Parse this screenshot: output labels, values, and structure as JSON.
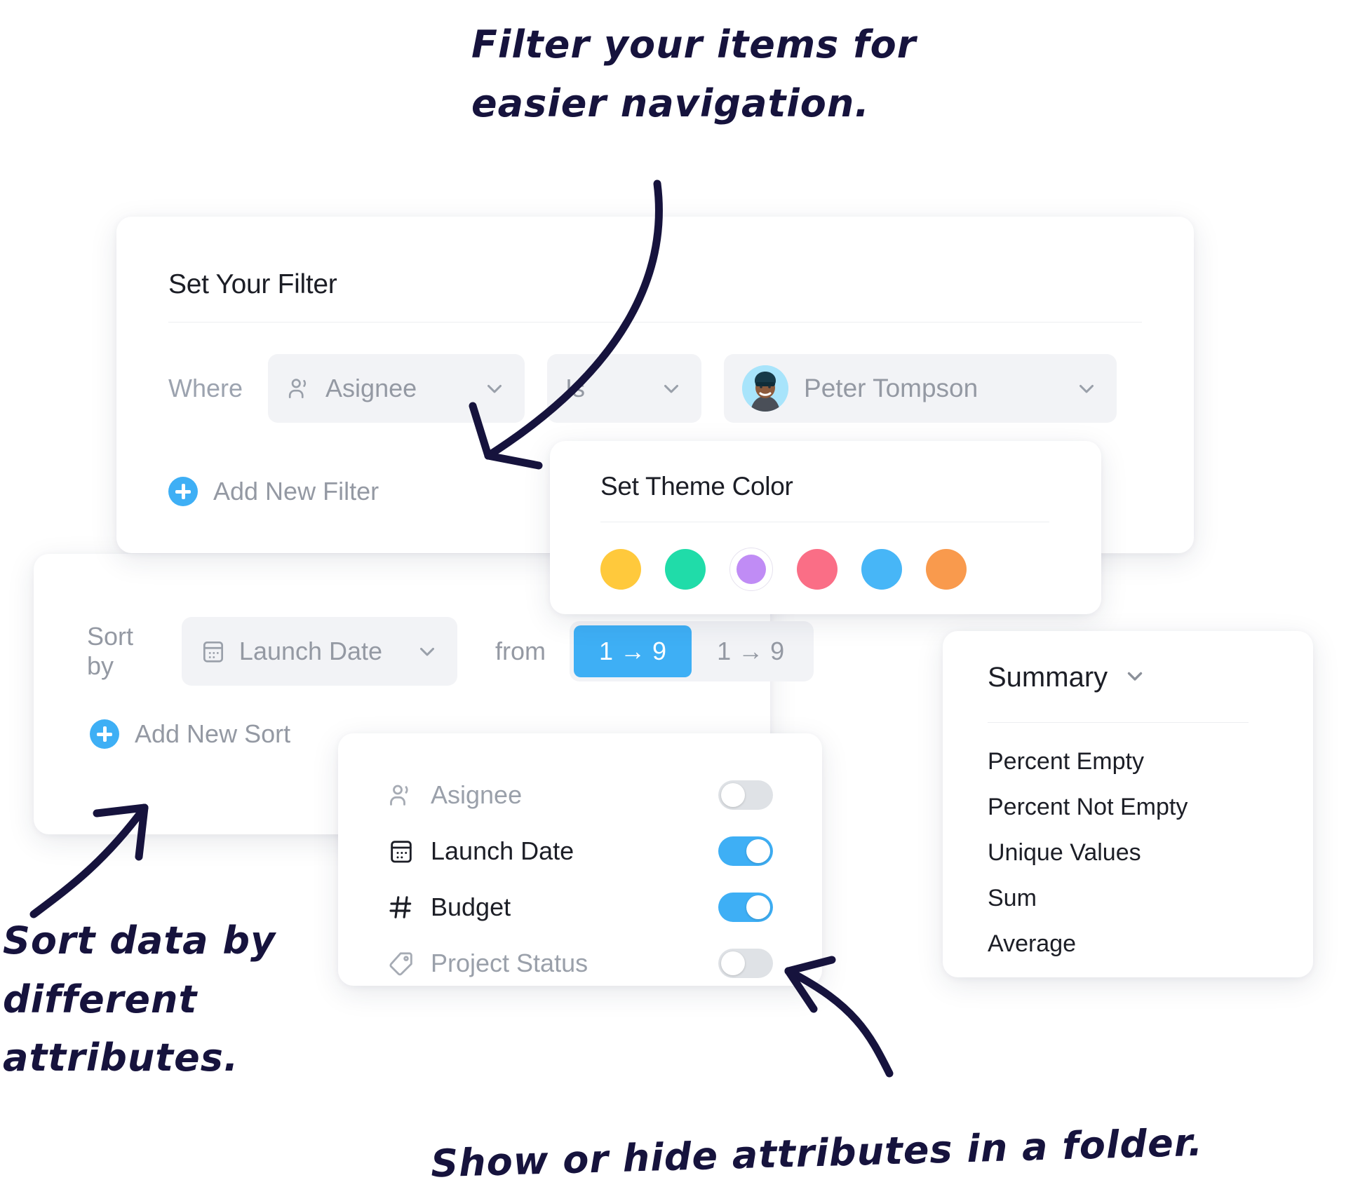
{
  "annotations": {
    "filter_note": "Filter your items for\neasier navigation.",
    "sort_note": "Sort data by\ndifferent\nattributes.",
    "attrs_note": "Show or hide attributes in a folder.",
    "ink_color": "#16133d"
  },
  "filter_panel": {
    "title": "Set Your Filter",
    "where_label": "Where",
    "field": {
      "icon": "person-icon",
      "value": "Asignee",
      "chevron": "chevron-down-icon"
    },
    "operator": {
      "value": "Is",
      "chevron": "chevron-down-icon"
    },
    "value": {
      "avatar": "avatar-peter",
      "name": "Peter Tompson",
      "chevron": "chevron-down-icon"
    },
    "add_filter_label": "Add New Filter"
  },
  "sort_panel": {
    "sort_by_label": "Sort by",
    "field": {
      "icon": "calendar-icon",
      "value": "Launch Date",
      "chevron": "chevron-down-icon"
    },
    "from_label": "from",
    "direction_options": [
      {
        "label": "1 → 9",
        "selected": true
      },
      {
        "label": "1 → 9",
        "selected": false
      }
    ],
    "add_sort_label": "Add New Sort"
  },
  "theme_panel": {
    "title": "Set Theme Color",
    "colors": [
      {
        "name": "yellow",
        "hex": "#FFC93C",
        "selected": false
      },
      {
        "name": "teal",
        "hex": "#20DCA9",
        "selected": false
      },
      {
        "name": "purple",
        "hex": "#C08CF5",
        "selected": true
      },
      {
        "name": "pink",
        "hex": "#FA6E86",
        "selected": false
      },
      {
        "name": "blue",
        "hex": "#47B6F7",
        "selected": false
      },
      {
        "name": "orange",
        "hex": "#F99A4D",
        "selected": false
      }
    ]
  },
  "attributes_panel": {
    "items": [
      {
        "icon": "person-icon",
        "label": "Asignee",
        "enabled": false
      },
      {
        "icon": "calendar-icon",
        "label": "Launch Date",
        "enabled": true
      },
      {
        "icon": "hash-icon",
        "label": "Budget",
        "enabled": true
      },
      {
        "icon": "tag-icon",
        "label": "Project Status",
        "enabled": false
      }
    ]
  },
  "summary_panel": {
    "title": "Summary",
    "chevron": "chevron-down-icon",
    "items": [
      "Percent Empty",
      "Percent Not Empty",
      "Unique Values",
      "Sum",
      "Average"
    ]
  },
  "accent": {
    "blue": "#3eaff5",
    "muted_text": "#9499a3",
    "dark_text": "#1c1e26"
  }
}
